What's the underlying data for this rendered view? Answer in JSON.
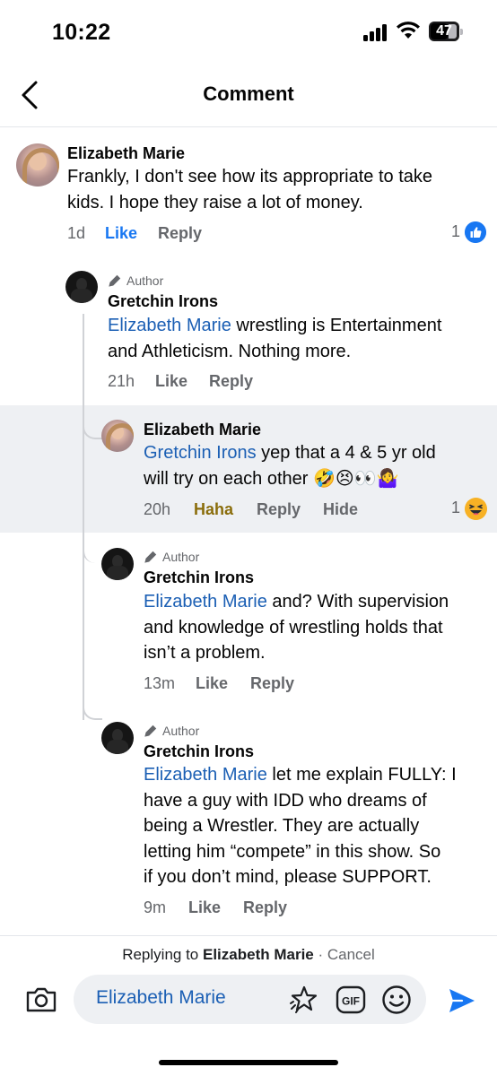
{
  "status_bar": {
    "time": "10:22",
    "battery": "47"
  },
  "header": {
    "title": "Comment"
  },
  "comments": [
    {
      "name": "Elizabeth Marie",
      "text_lines": [
        "Frankly, I don't see how its appropriate to take",
        "kids. I hope they raise a lot of money."
      ],
      "time": "1d",
      "like_label": "Like",
      "reply_label": "Reply",
      "reaction_count": "1"
    },
    {
      "author_tag": "Author",
      "name": "Gretchin Irons",
      "mention": "Elizabeth Marie",
      "text_first": " wrestling is Entertainment",
      "text_lines": [
        "and Athleticism. Nothing more."
      ],
      "time": "21h",
      "like_label": "Like",
      "reply_label": "Reply"
    },
    {
      "name": "Elizabeth Marie",
      "mention": "Gretchin Irons",
      "text_first": " yep that a 4 & 5 yr old",
      "text_second": "will try on each other 🤣😣👀🤷‍♀️",
      "time": "20h",
      "like_label": "Haha",
      "reply_label": "Reply",
      "hide_label": "Hide",
      "reaction_count": "1"
    },
    {
      "author_tag": "Author",
      "name": "Gretchin Irons",
      "mention": "Elizabeth Marie",
      "text_first": " and? With supervision",
      "text_lines": [
        "and knowledge of wrestling holds that",
        "isn’t a problem."
      ],
      "time": "13m",
      "like_label": "Like",
      "reply_label": "Reply"
    },
    {
      "author_tag": "Author",
      "name": "Gretchin Irons",
      "mention": "Elizabeth Marie",
      "text_first": " let me explain FULLY: I",
      "text_lines": [
        "have a guy with IDD who dreams of",
        "being a Wrestler. They are actually",
        "letting him “compete” in this show. So",
        "if you don’t mind, please SUPPORT."
      ],
      "time": "9m",
      "like_label": "Like",
      "reply_label": "Reply"
    }
  ],
  "composer": {
    "replying_prefix": "Replying to",
    "replying_name": "Elizabeth Marie",
    "separator": " · ",
    "cancel_label": "Cancel",
    "input_value": "Elizabeth Marie"
  }
}
